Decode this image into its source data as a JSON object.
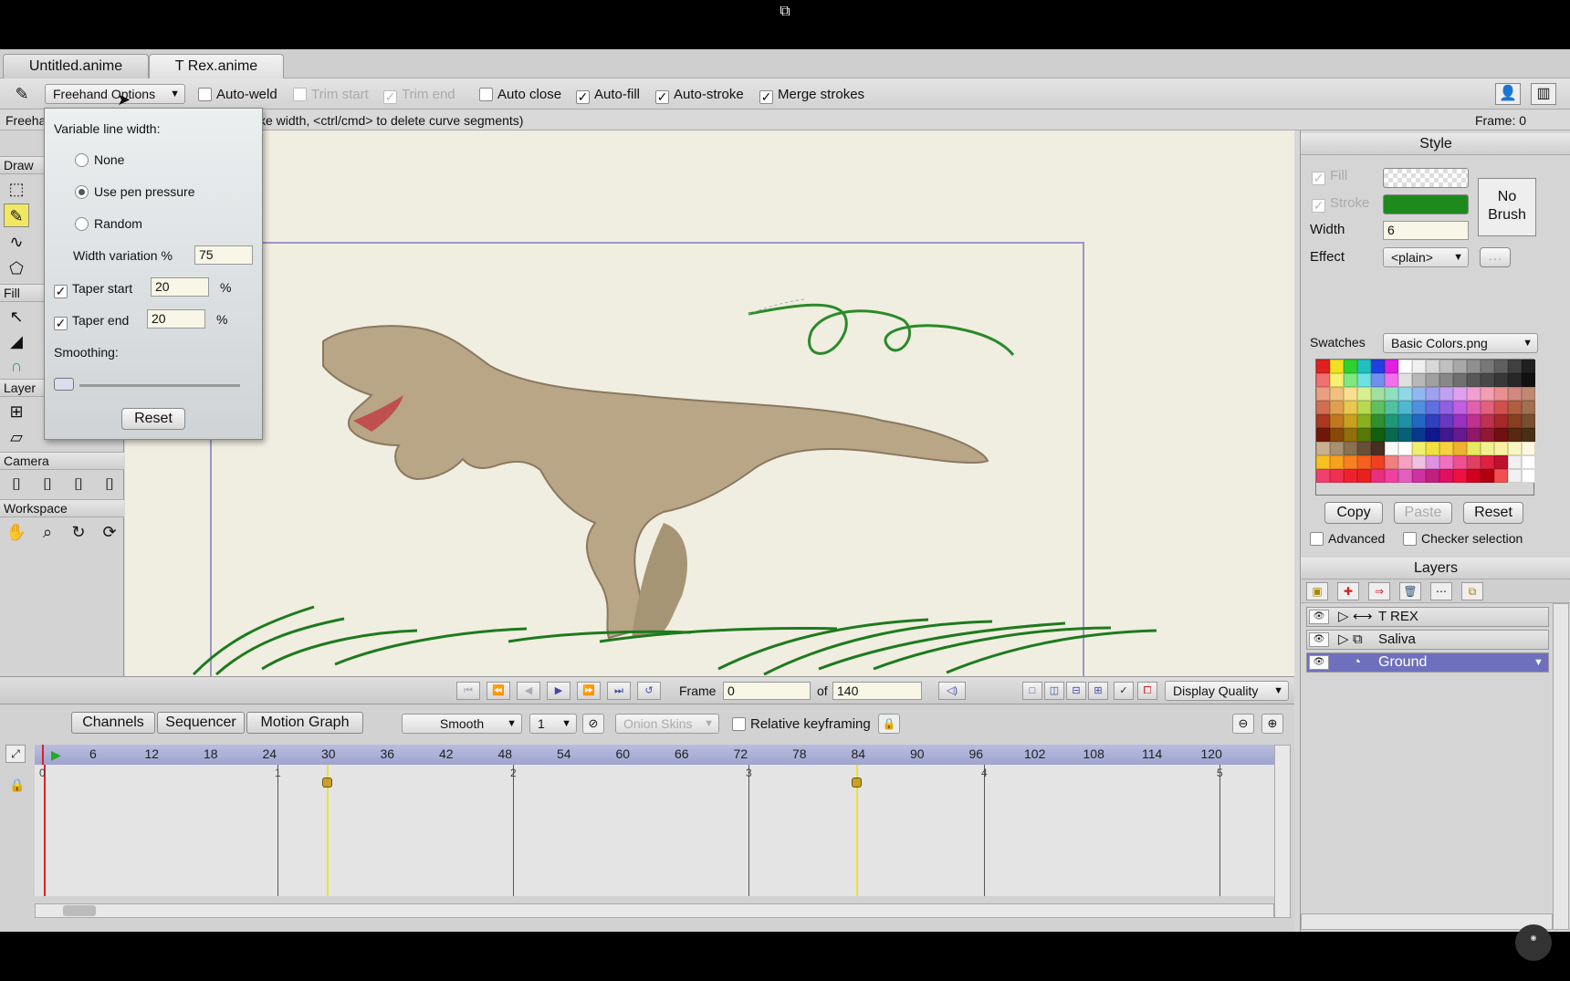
{
  "tabs": [
    {
      "label": "Untitled.anime"
    },
    {
      "label": "T Rex.anime"
    }
  ],
  "options": {
    "freehand_label": "Freehand Options",
    "auto_weld": "Auto-weld",
    "trim_start": "Trim start",
    "trim_end": "Trim end",
    "auto_close": "Auto close",
    "auto_fill": "Auto-fill",
    "auto_stroke": "Auto-stroke",
    "merge_strokes": "Merge strokes"
  },
  "status": {
    "tool": "Freeha",
    "hint": "ke width, <ctrl/cmd> to delete curve segments)",
    "frame": "Frame: 0"
  },
  "tools": {
    "draw": "Draw",
    "fill": "Fill",
    "layer": "Layer",
    "camera": "Camera",
    "workspace": "Workspace"
  },
  "popup": {
    "title": "Variable line width:",
    "none": "None",
    "pen": "Use pen pressure",
    "random": "Random",
    "width_var_label": "Width variation %",
    "width_var": "75",
    "taper_start_label": "Taper start",
    "taper_start": "20",
    "taper_end_label": "Taper end",
    "taper_end": "20",
    "pct": "%",
    "smoothing": "Smoothing:",
    "reset": "Reset"
  },
  "style": {
    "header": "Style",
    "fill": "Fill",
    "stroke": "Stroke",
    "width_label": "Width",
    "width": "6",
    "effect_label": "Effect",
    "effect": "<plain>",
    "no_brush": "No Brush",
    "swatches_label": "Swatches",
    "swatches": "Basic Colors.png",
    "copy": "Copy",
    "paste": "Paste",
    "reset": "Reset",
    "advanced": "Advanced",
    "checker": "Checker selection",
    "stroke_color": "#1e8a1e"
  },
  "layers": {
    "header": "Layers",
    "items": [
      {
        "name": "T REX"
      },
      {
        "name": "Saliva"
      },
      {
        "name": "Ground"
      }
    ]
  },
  "playback": {
    "frame_label": "Frame",
    "frame": "0",
    "of_label": "of",
    "total": "140",
    "display_quality": "Display Quality"
  },
  "timeline": {
    "tabs": [
      "Channels",
      "Sequencer",
      "Motion Graph"
    ],
    "interp": "Smooth",
    "interval": "1",
    "onion": "Onion Skins",
    "relative": "Relative keyframing",
    "ruler": [
      "6",
      "12",
      "18",
      "24",
      "30",
      "36",
      "42",
      "48",
      "54",
      "60",
      "66",
      "72",
      "78",
      "84",
      "90",
      "96",
      "102",
      "108",
      "114",
      "120"
    ],
    "seconds": [
      "0",
      "1",
      "2",
      "3",
      "4",
      "5"
    ]
  }
}
